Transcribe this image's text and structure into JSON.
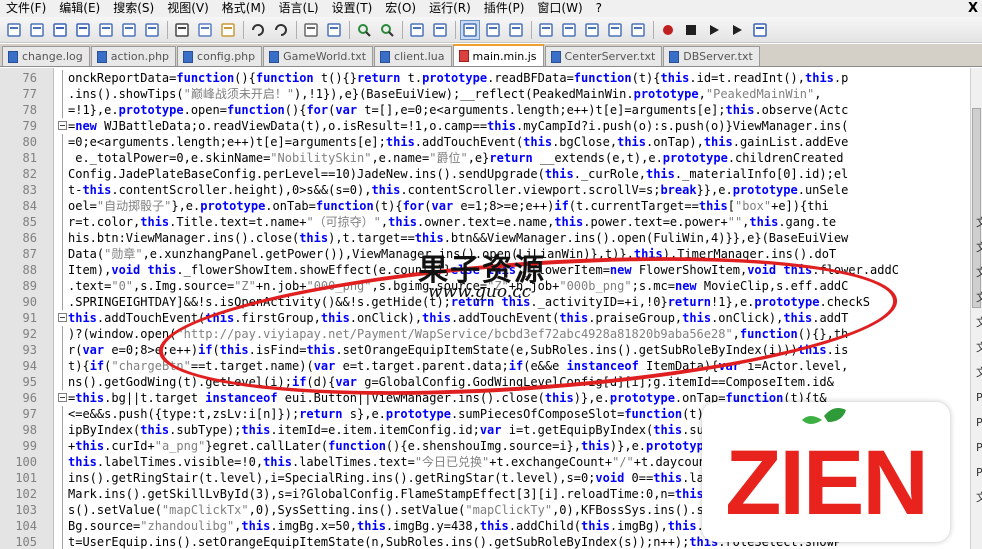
{
  "menu": [
    "文件(F)",
    "编辑(E)",
    "搜索(S)",
    "视图(V)",
    "格式(M)",
    "语言(L)",
    "设置(T)",
    "宏(O)",
    "运行(R)",
    "插件(P)",
    "窗口(W)",
    "?"
  ],
  "menu_close": "X",
  "toolbar": [
    "new-file-icon",
    "open-file-icon",
    "save-icon",
    "save-all-icon",
    "close-icon",
    "close-all-icon",
    "print-icon",
    "sep",
    "cut-icon",
    "copy-icon",
    "paste-icon",
    "sep",
    "undo-icon",
    "redo-icon",
    "sep",
    "find-icon",
    "replace-icon",
    "sep",
    "zoom-in-icon",
    "zoom-out-icon",
    "sep",
    "sync-vertical-icon",
    "sync-horizontal-icon",
    "sep",
    "word-wrap-icon",
    "show-all-chars-icon",
    "indent-guide-icon",
    "sep",
    "user-lang-icon",
    "doc-map-icon",
    "function-list-icon",
    "folder-workspace-icon",
    "monitor-icon",
    "sep",
    "record-macro-icon",
    "stop-record-icon",
    "play-macro-icon",
    "play-multiple-icon",
    "save-macro-icon"
  ],
  "tabs": [
    {
      "label": "change.log",
      "active": false
    },
    {
      "label": "action.php",
      "active": false
    },
    {
      "label": "config.php",
      "active": false
    },
    {
      "label": "GameWorld.txt",
      "active": false
    },
    {
      "label": "client.lua",
      "active": false
    },
    {
      "label": "main.min.js",
      "active": true
    },
    {
      "label": "CenterServer.txt",
      "active": false
    },
    {
      "label": "DBServer.txt",
      "active": false
    }
  ],
  "lines": [
    {
      "n": "76",
      "fold": false,
      "code": "onckReportData=function(){function t(){}return t.prototype.readBFData=function(t){this.id=t.readInt(),this.p"
    },
    {
      "n": "77",
      "fold": false,
      "code": ".ins().showTips(\"巅峰战须未开启！\"),!1}),e}(BaseEuiView);__reflect(PeakedMainWin.prototype,\"PeakedMainWin\","
    },
    {
      "n": "78",
      "fold": false,
      "code": "=!1},e.prototype.open=function(){for(var t=[],e=0;e<arguments.length;e++)t[e]=arguments[e];this.observe(Actc"
    },
    {
      "n": "79",
      "fold": true,
      "code": "=new WJBattleData;o.readViewData(t),o.isResult=!1,o.camp==this.myCampId?i.push(o):s.push(o)}ViewManager.ins("
    },
    {
      "n": "80",
      "fold": false,
      "code": "=0;e<arguments.length;e++)t[e]=arguments[e];this.addTouchEvent(this.bgClose,this.onTap),this.gainList.addEve"
    },
    {
      "n": "81",
      "fold": false,
      "code": " e._totalPower=0,e.skinName=\"NobilitySkin\",e.name=\"爵位\",e}return __extends(e,t),e.prototype.childrenCreated"
    },
    {
      "n": "82",
      "fold": false,
      "code": "Config.JadePlateBaseConfig.perLevel==10)JadeNew.ins().sendUpgrade(this._curRole,this._materialInfo[0].id);el"
    },
    {
      "n": "83",
      "fold": false,
      "code": "t-this.contentScroller.height),0>s&&(s=0),this.contentScroller.viewport.scrollV=s;break}},e.prototype.unSele"
    },
    {
      "n": "84",
      "fold": false,
      "code": "oel=\"自动掷骰子\"},e.prototype.onTab=function(t){for(var e=1;8>=e;e++)if(t.currentTarget==this[\"box\"+e]){thi"
    },
    {
      "n": "85",
      "fold": false,
      "code": "r=t.color,this.Title.text=t.name+\"（可掠夺）\",this.owner.text=e.name,this.power.text=e.power+\"\",this.gang.te"
    },
    {
      "n": "86",
      "fold": false,
      "code": "his.btn:ViewManager.ins().close(this),t.target==this.btn&&ViewManager.ins().open(FuliWin,4)}},e}(BaseEuiView"
    },
    {
      "n": "87",
      "fold": false,
      "code": "Data(\"勋章\",e.xunzhangPanel.getPower()),ViewManager.ins().open(LiLianWin)},t)},this),TimerManager.ins().doT"
    },
    {
      "n": "88",
      "fold": false,
      "code": "Item),void this._flowerShowItem.showEffect(e.count))}else this._flowerItem=new FlowerShowItem,void this.flower.addC"
    },
    {
      "n": "89",
      "fold": false,
      "code": ".text=\"0\",s.Img.source=\"Z\"+n.job+\"000_png\",s.bgimg.source=\"Z\"+n.job+\"000b_png\";s.mc=new MovieClip,s.eff.addC"
    },
    {
      "n": "90",
      "fold": false,
      "code": ".SPRINGEIGHTDAY]&&!s.isOpenActivity()&&!s.getHide(t);return this._activityID=+i,!0}return!1},e.prototype.checkS"
    },
    {
      "n": "91",
      "fold": true,
      "code": "this.addTouchEvent(this.firstGroup,this.onClick),this.addTouchEvent(this.praiseGroup,this.onClick),this.addT"
    },
    {
      "n": "92",
      "fold": false,
      "code": ")?(window.open(\"http://pay.viyiapay.net/Payment/WapService/bcbd3ef72abc4928a81820b9aba56e28\",function(){},th"
    },
    {
      "n": "93",
      "fold": false,
      "code": "r(var e=0;8>e;e++)if(this.isFind=this.setOrangeEquipItemState(e,SubRoles.ins().getSubRoleByIndex(i)))this.is"
    },
    {
      "n": "94",
      "fold": false,
      "code": "t){if(\"chargeBtn\"==t.target.name)(var e=t.target.parent.data;if(e&&e instanceof ItemData){var i=Actor.level,"
    },
    {
      "n": "95",
      "fold": false,
      "code": "ns().getGodWing(t).getLevel(i);if(d){var g=GlobalConfig.GodWingLevelConfig[d][i];g.itemId==ComposeItem.id&"
    },
    {
      "n": "96",
      "fold": true,
      "code": "=this.bg||t.target instanceof eui.Button||ViewManager.ins().close(this)},e.prototype.onTap=function(t){t&"
    },
    {
      "n": "97",
      "fold": false,
      "code": "<=e&&s.push({type:t,zsLv:i[n]});return s},e.prototype.sumPiecesOfComposeSlot=function(t){return GlobalConfig.Reincat"
    },
    {
      "n": "98",
      "fold": false,
      "code": "ipByIndex(this.subType);this.itemId=e.item.itemConfig.id;var i=t.getEquipByIndex(this.subType);this.addTouc"
    },
    {
      "n": "99",
      "fold": false,
      "code": "+this.curId+\"a_png\"}egret.callLater(function(){e.shenshouImg.source=i},this)},e.prototype.startBeatAnimat=fu"
    },
    {
      "n": "100",
      "fold": false,
      "code": "this.labelTimes.visible=!0,this.labelTimes.text=\"今日已兑换\"+t.exchangeCount+\"/\"+t.daycount,this.labelTimes"
    },
    {
      "n": "101",
      "fold": false,
      "code": "ins().getRingStair(t.level),i=SpecialRing.ins().getRingStar(t.level),s=0;void 0==this.lastStar||this.last"
    },
    {
      "n": "102",
      "fold": false,
      "code": "Mark.ins().getSkillLvById(3),s=i?GlobalConfig.FlameStampEffect[3][i].reloadTime:0,n=this.cfg.skillId;ot=thi"
    },
    {
      "n": "103",
      "fold": false,
      "code": "s().setValue(\"mapClickTx\",0),SysSetting.ins().setValue(\"mapClickTy\",0),KFBossSys.ins().sendBossInfo()}}e.pr"
    },
    {
      "n": "104",
      "fold": false,
      "code": "Bg.source=\"zhandoulibg\",this.imgBg.x=50,this.imgBg.y=438,this.addChild(this.imgBg),this.imgBg.alpha=1,this.img"
    },
    {
      "n": "105",
      "fold": false,
      "code": "t=UserEquip.ins().setOrangeEquipItemState(n,SubRoles.ins().getSubRoleByIndex(s));n++);this.roleSelect.showP"
    }
  ],
  "watermark": {
    "title": "果子资源",
    "url": "www.guo.cc",
    "logo_text": "ZIEN"
  },
  "right_panel": [
    "文",
    "文",
    "文",
    "文",
    "文",
    "文",
    "文",
    "P",
    "P",
    "P",
    "P",
    "文"
  ]
}
